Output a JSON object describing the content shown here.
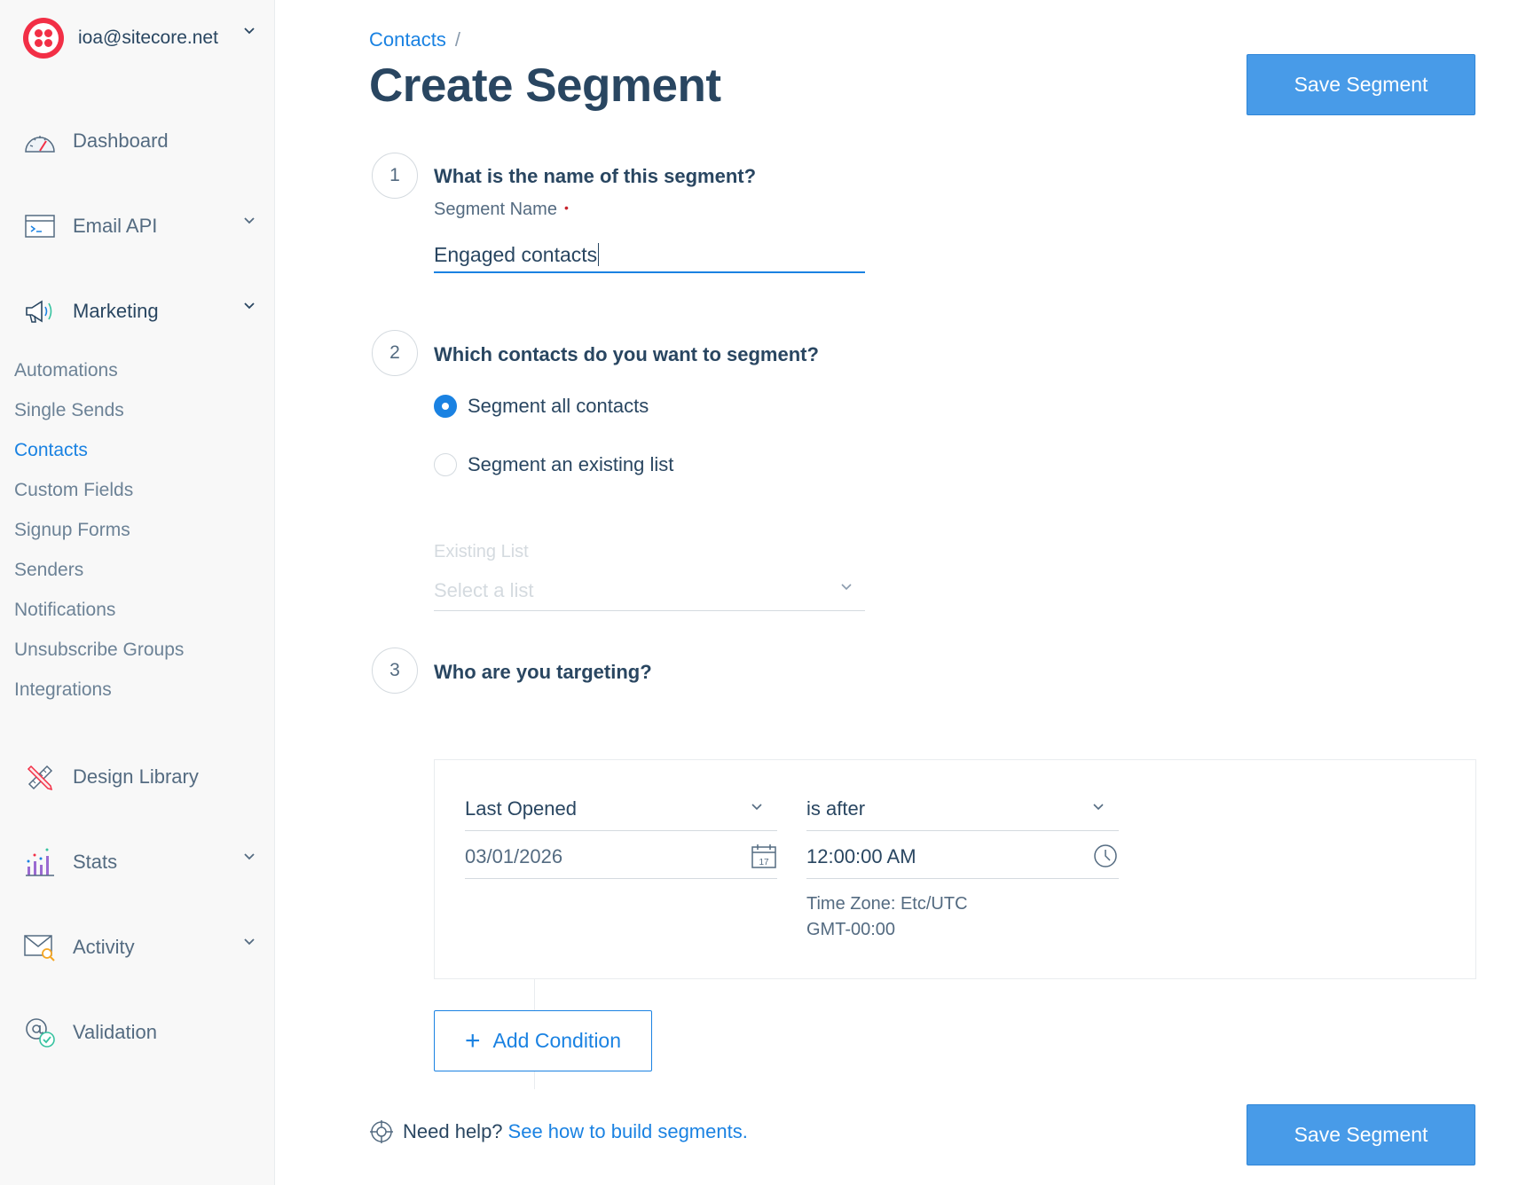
{
  "account": {
    "email": "ioa@sitecore.net"
  },
  "sidebar": {
    "main_items": [
      {
        "label": "Dashboard",
        "icon": "dashboard-gauge-icon"
      },
      {
        "label": "Email API",
        "icon": "email-api-terminal-icon"
      },
      {
        "label": "Marketing",
        "icon": "megaphone-icon"
      },
      {
        "label": "Design Library",
        "icon": "design-pencil-ruler-icon"
      },
      {
        "label": "Stats",
        "icon": "stats-bar-chart-icon"
      },
      {
        "label": "Activity",
        "icon": "activity-envelope-search-icon"
      },
      {
        "label": "Validation",
        "icon": "validation-at-check-icon"
      }
    ],
    "marketing_items": [
      "Automations",
      "Single Sends",
      "Contacts",
      "Custom Fields",
      "Signup Forms",
      "Senders",
      "Notifications",
      "Unsubscribe Groups",
      "Integrations"
    ]
  },
  "breadcrumb": {
    "parent": "Contacts",
    "separator": "/"
  },
  "page": {
    "title": "Create Segment",
    "save_label": "Save Segment"
  },
  "step1": {
    "number": "1",
    "question": "What is the name of this segment?",
    "field_label": "Segment Name",
    "required_mark": "•",
    "value": "Engaged contacts"
  },
  "step2": {
    "number": "2",
    "question": "Which contacts do you want to segment?",
    "option_all": "Segment all contacts",
    "option_list": "Segment an existing list",
    "selected": "all",
    "list_label": "Existing List",
    "list_placeholder": "Select a list"
  },
  "step3": {
    "number": "3",
    "question": "Who are you targeting?",
    "condition": {
      "field": "Last Opened",
      "operator": "is after",
      "date": "03/01/2026",
      "time": "12:00:00 AM",
      "timezone": "Time Zone: Etc/UTC",
      "offset": "GMT-00:00",
      "calendar_day": "17"
    },
    "add_label": "Add Condition"
  },
  "help": {
    "prefix": "Need help?",
    "link": "See how to build segments."
  },
  "colors": {
    "accent": "#1a82e2",
    "button": "#489be8",
    "brand_logo": "#f22f46",
    "text": "#294661"
  }
}
